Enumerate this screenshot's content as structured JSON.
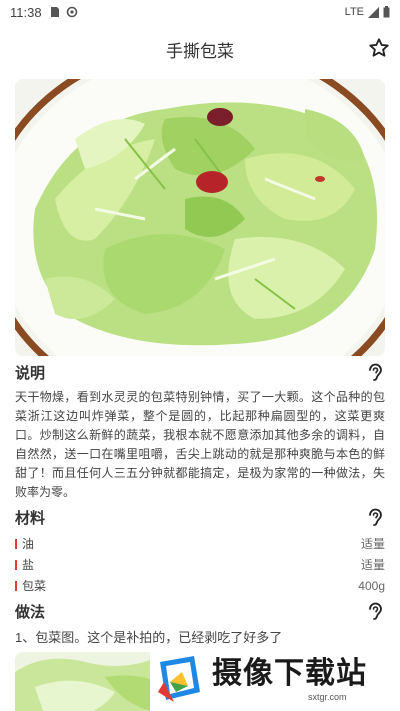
{
  "status_bar": {
    "time": "11:38",
    "network": "LTE"
  },
  "app_bar": {
    "title": "手撕包菜",
    "favorite_icon": "star-outline-icon"
  },
  "sections": {
    "description": {
      "heading": "说明",
      "text": "天干物燥，看到水灵灵的包菜特别钟情，买了一大颗。这个品种的包菜浙江这边叫炸弹菜，整个是圆的，比起那种扁圆型的，这菜更爽口。炒制这么新鲜的蔬菜，我根本就不愿意添加其他多余的调料，自自然然，送一口在嘴里咀嚼，舌尖上跳动的就是那种爽脆与本色的鲜甜了！而且任何人三五分钟就都能搞定，是极为家常的一种做法，失败率为零。"
    },
    "ingredients": {
      "heading": "材料",
      "items": [
        {
          "name": "油",
          "amount": "适量"
        },
        {
          "name": "盐",
          "amount": "适量"
        },
        {
          "name": "包菜",
          "amount": "400g"
        }
      ]
    },
    "method": {
      "heading": "做法",
      "steps": [
        "1、包菜图。这个是补拍的，已经剥吃了好多了"
      ]
    }
  },
  "watermark": {
    "brand": "摄像下载站",
    "domain": "sxtgr.com"
  },
  "colors": {
    "accent_bar": "#e53935",
    "plate_rim": "#8a4b22",
    "cabbage": "#a9d86a"
  }
}
